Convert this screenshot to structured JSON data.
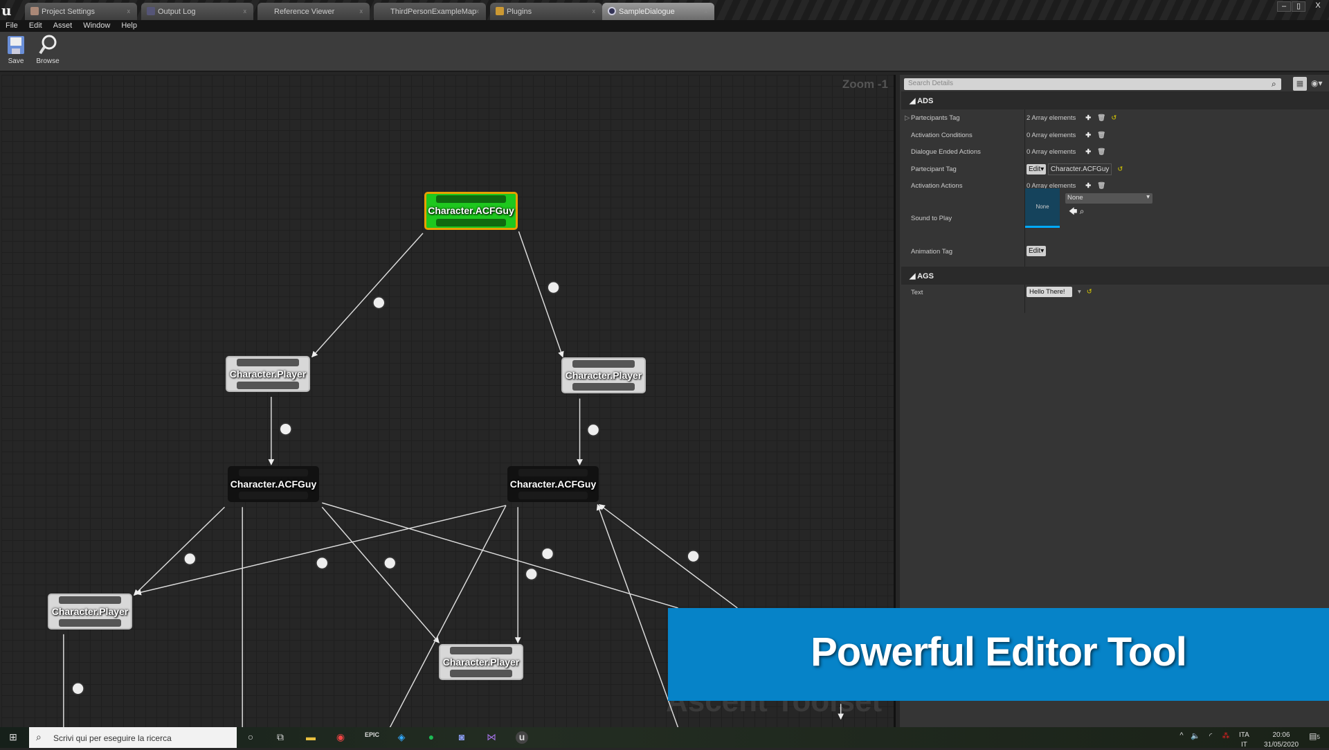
{
  "tabs": [
    {
      "label": "Project Settings",
      "icon": "settings-icon"
    },
    {
      "label": "Output Log",
      "icon": "log-icon"
    },
    {
      "label": "Reference Viewer",
      "icon": ""
    },
    {
      "label": "ThirdPersonExampleMap",
      "icon": ""
    },
    {
      "label": "Plugins",
      "icon": "plugin-icon"
    },
    {
      "label": "SampleDialogue",
      "icon": "dialogue-asset-icon",
      "active": true
    }
  ],
  "menu": [
    "File",
    "Edit",
    "Asset",
    "Window",
    "Help"
  ],
  "toolbar": {
    "save": "Save",
    "browse": "Browse"
  },
  "graph": {
    "zoom": "Zoom -1",
    "watermark": "Ascent Toolset",
    "nodes": [
      {
        "label": "Character.ACFGuy",
        "state": "selected"
      },
      {
        "label": "Character.Player"
      },
      {
        "label": "Character.Player"
      },
      {
        "label": "Character.ACFGuy"
      },
      {
        "label": "Character.ACFGuy"
      },
      {
        "label": "Character.Player"
      },
      {
        "label": "Character.Player"
      }
    ]
  },
  "details": {
    "search_placeholder": "Search Details",
    "ads": {
      "title": "ADS",
      "rows": [
        {
          "label": "Partecipants Tag",
          "value": "2 Array elements"
        },
        {
          "label": "Activation Conditions",
          "value": "0 Array elements"
        },
        {
          "label": "Dialogue Ended Actions",
          "value": "0 Array elements"
        },
        {
          "label": "Partecipant Tag",
          "edit": "Edit",
          "value": "Character.ACFGuy"
        },
        {
          "label": "Activation Actions",
          "value": "0 Array elements"
        },
        {
          "label": "Sound to Play",
          "thumb": "None",
          "value": "None"
        },
        {
          "label": "Animation Tag",
          "edit": "Edit"
        }
      ]
    },
    "ags": {
      "title": "AGS",
      "rows": [
        {
          "label": "Text",
          "value": "Hello There!"
        }
      ]
    }
  },
  "banner": "Powerful Editor Tool",
  "taskbar": {
    "search_placeholder": "Scrivi qui per eseguire la ricerca",
    "lang1": "ITA",
    "lang2": "IT",
    "time": "20:06",
    "date": "31/05/2020",
    "notifications": "5"
  },
  "colors": {
    "selected_node": "#1ec81e",
    "selected_border": "#e8a000",
    "banner": "#0683c8",
    "accent": "#00aaff"
  }
}
